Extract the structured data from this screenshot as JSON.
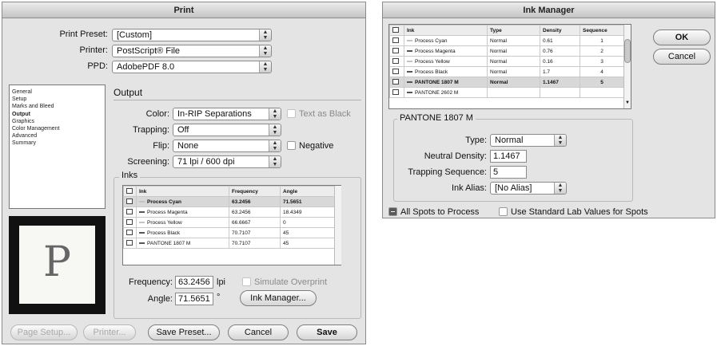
{
  "print": {
    "title": "Print",
    "preset_label": "Print Preset:",
    "preset_value": "[Custom]",
    "printer_label": "Printer:",
    "printer_value": "PostScript® File",
    "ppd_label": "PPD:",
    "ppd_value": "AdobePDF 8.0",
    "sidebar": [
      "General",
      "Setup",
      "Marks and Bleed",
      "Output",
      "Graphics",
      "Color Management",
      "Advanced",
      "Summary"
    ],
    "sidebar_selected": 3,
    "preview_letter": "P",
    "section": "Output",
    "color_label": "Color:",
    "color_value": "In-RIP Separations",
    "text_as_black": "Text as Black",
    "trapping_label": "Trapping:",
    "trapping_value": "Off",
    "flip_label": "Flip:",
    "flip_value": "None",
    "negative": "Negative",
    "screening_label": "Screening:",
    "screening_value": "71 lpi / 600 dpi",
    "inks_label": "Inks",
    "ink_headers": [
      "Ink",
      "Frequency",
      "Angle"
    ],
    "ink_rows": [
      {
        "name": "Process Cyan",
        "frequency": "63.2456",
        "angle": "71.5651",
        "selected": true
      },
      {
        "name": "Process Magenta",
        "frequency": "63.2456",
        "angle": "18.4349"
      },
      {
        "name": "Process Yellow",
        "frequency": "66.6667",
        "angle": "0"
      },
      {
        "name": "Process Black",
        "frequency": "70.7107",
        "angle": "45"
      },
      {
        "name": "PANTONE 1807 M",
        "frequency": "70.7107",
        "angle": "45"
      }
    ],
    "frequency_label": "Frequency:",
    "frequency_value": "63.2456",
    "frequency_unit": "lpi",
    "angle_label": "Angle:",
    "angle_value": "71.5651",
    "angle_unit": "°",
    "simulate_overprint": "Simulate Overprint",
    "ink_manager_btn": "Ink Manager...",
    "page_setup_btn": "Page Setup...",
    "printer_btn": "Printer...",
    "save_preset_btn": "Save Preset...",
    "cancel_btn": "Cancel",
    "save_btn": "Save"
  },
  "ink_manager": {
    "title": "Ink Manager",
    "headers": [
      "Ink",
      "Type",
      "Density",
      "Sequence"
    ],
    "rows": [
      {
        "name": "Process Cyan",
        "type": "Normal",
        "density": "0.61",
        "sequence": "1"
      },
      {
        "name": "Process Magenta",
        "type": "Normal",
        "density": "0.76",
        "sequence": "2"
      },
      {
        "name": "Process Yellow",
        "type": "Normal",
        "density": "0.16",
        "sequence": "3"
      },
      {
        "name": "Process Black",
        "type": "Normal",
        "density": "1.7",
        "sequence": "4"
      },
      {
        "name": "PANTONE 1807 M",
        "type": "Normal",
        "density": "1.1467",
        "sequence": "5",
        "selected": true
      },
      {
        "name": "PANTONE 2602 M",
        "type": "",
        "density": "",
        "sequence": ""
      }
    ],
    "ok_btn": "OK",
    "cancel_btn": "Cancel",
    "group_title": "PANTONE 1807 M",
    "type_label": "Type:",
    "type_value": "Normal",
    "density_label": "Neutral Density:",
    "density_value": "1.1467",
    "trap_seq_label": "Trapping Sequence:",
    "trap_seq_value": "5",
    "alias_label": "Ink Alias:",
    "alias_value": "[No Alias]",
    "all_spots": "All Spots to Process",
    "std_lab": "Use Standard Lab Values for Spots"
  }
}
